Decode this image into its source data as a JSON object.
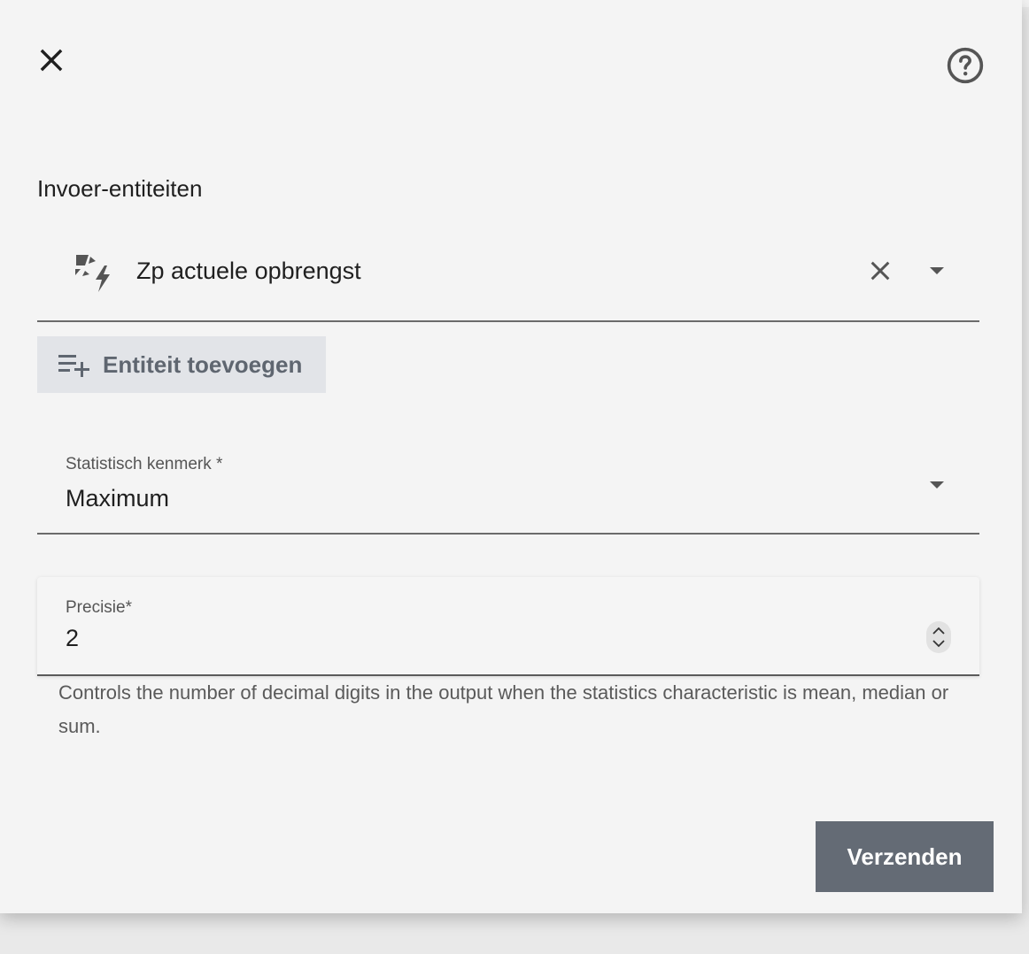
{
  "dialog": {
    "close_icon": "close-icon",
    "help_icon": "help-circle-icon"
  },
  "entities": {
    "section_label": "Invoer-entiteiten",
    "items": [
      {
        "name": "Zp actuele opbrengst",
        "icon": "solar-power-icon"
      }
    ],
    "add_label": "Entiteit toevoegen"
  },
  "characteristic": {
    "label": "Statistisch kenmerk *",
    "value": "Maximum"
  },
  "precision": {
    "label": "Precisie*",
    "value": "2",
    "helper": "Controls the number of decimal digits in the output when the statistics characteristic is mean, median or sum."
  },
  "actions": {
    "submit_label": "Verzenden"
  },
  "colors": {
    "background": "#f4f4f4",
    "button_bg": "#646b75",
    "add_button_bg": "#e2e4e8"
  }
}
